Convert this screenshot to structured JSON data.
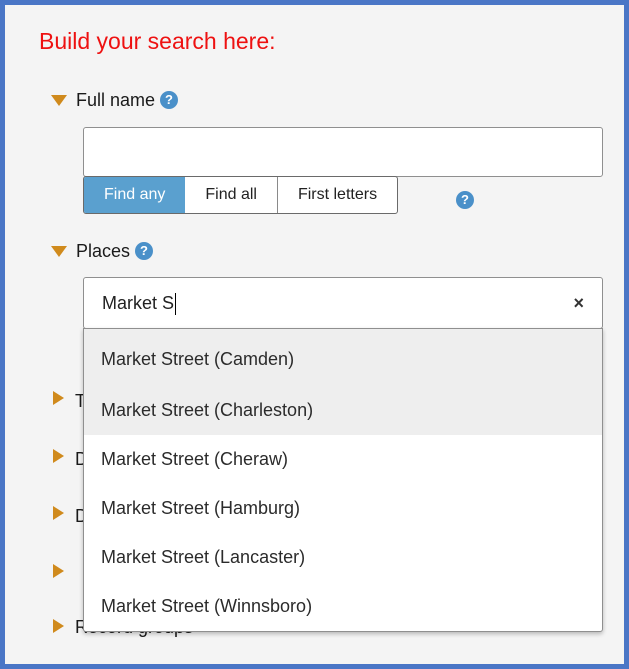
{
  "title": "Build your search here:",
  "full_name": {
    "label": "Full name",
    "value": "",
    "match_modes": [
      "Find any",
      "Find all",
      "First letters"
    ],
    "selected_mode": "Find any"
  },
  "places": {
    "label": "Places",
    "value": "Market S",
    "clear_symbol": "×",
    "suggestions": [
      "Market Street (Camden)",
      "Market Street (Charleston)",
      "Market Street (Cheraw)",
      "Market Street (Hamburg)",
      "Market Street (Lancaster)",
      "Market Street (Winnsboro)"
    ]
  },
  "collapsed_sections": {
    "partial_letters": [
      "T",
      "D",
      "D",
      ""
    ],
    "record_groups": "Record groups"
  },
  "help_symbol": "?",
  "colors": {
    "title": "#ee1111",
    "arrow": "#d08a1c",
    "help": "#4a90c9",
    "active_mode": "#5aa0cf",
    "frame": "#4a76c6"
  }
}
